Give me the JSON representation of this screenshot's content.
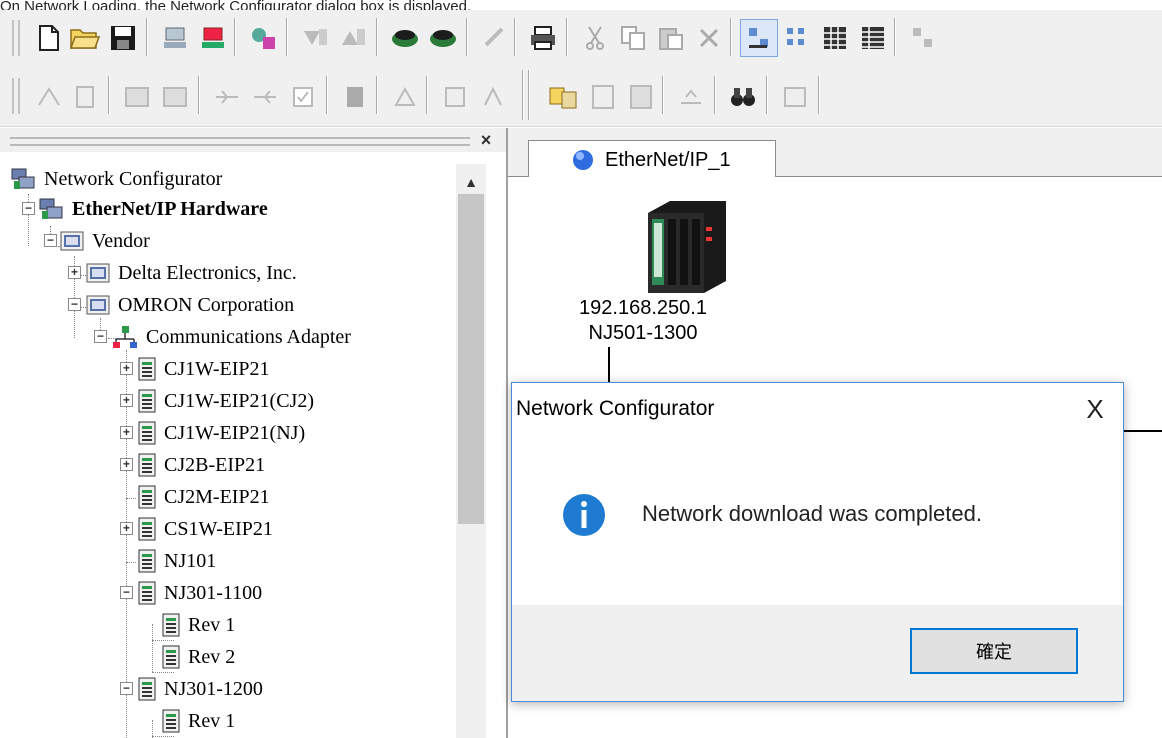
{
  "caption": "On Network Loading, the Network Configurator dialog box is displayed.",
  "toolbar1": {
    "buttons": [
      "new-file",
      "open-folder",
      "save",
      "online",
      "offline",
      "wizard",
      "upload-down",
      "upload",
      "upload-network",
      "download-network",
      "compare",
      "print",
      "cut",
      "copy",
      "paste",
      "delete",
      "view-large-icons",
      "view-small-icons",
      "view-list",
      "view-details",
      "more"
    ]
  },
  "toolbar2": {
    "buttons": [
      "monitor",
      "properties",
      "parameter-edit",
      "parameter-save",
      "online-a",
      "online-b",
      "checkbox",
      "register",
      "device-props",
      "device-list",
      "network-map",
      "eds-install",
      "eds-create",
      "eds-save",
      "eds-export",
      "find",
      "help"
    ]
  },
  "panel": {
    "close_symbol": "×",
    "scroll_up": "▲"
  },
  "tree": [
    {
      "label": "Network Configurator",
      "icon": "network-configurator-icon",
      "bold": false
    },
    {
      "label": "EtherNet/IP Hardware",
      "icon": "ethernet-hardware-icon",
      "bold": true,
      "expanded": true
    },
    {
      "label": "Vendor",
      "icon": "vendor-folder-icon",
      "bold": false,
      "expanded": true
    },
    {
      "label": "Delta Electronics, Inc.",
      "icon": "vendor-folder-icon",
      "bold": false,
      "expanded": false
    },
    {
      "label": "OMRON Corporation",
      "icon": "vendor-folder-icon",
      "bold": false,
      "expanded": true
    },
    {
      "label": "Communications Adapter",
      "icon": "communications-adapter-icon",
      "bold": false,
      "expanded": true
    },
    {
      "label": "CJ1W-EIP21",
      "icon": "device-icon",
      "expanded": false
    },
    {
      "label": "CJ1W-EIP21(CJ2)",
      "icon": "device-icon",
      "expanded": false
    },
    {
      "label": "CJ1W-EIP21(NJ)",
      "icon": "device-icon",
      "expanded": false
    },
    {
      "label": "CJ2B-EIP21",
      "icon": "device-icon",
      "expanded": false
    },
    {
      "label": "CJ2M-EIP21",
      "icon": "device-icon"
    },
    {
      "label": "CS1W-EIP21",
      "icon": "device-icon",
      "expanded": false
    },
    {
      "label": "NJ101",
      "icon": "device-icon"
    },
    {
      "label": "NJ301-1100",
      "icon": "device-icon",
      "expanded": true
    },
    {
      "label": "Rev 1",
      "icon": "device-icon"
    },
    {
      "label": "Rev 2",
      "icon": "device-icon"
    },
    {
      "label": "NJ301-1200",
      "icon": "device-icon",
      "expanded": true
    },
    {
      "label": "Rev 1",
      "icon": "device-icon"
    }
  ],
  "tab": {
    "label": "EtherNet/IP_1",
    "icon": "network-globe-icon"
  },
  "canvas": {
    "device_ip": "192.168.250.1",
    "device_model": "NJ501-1300"
  },
  "dialog": {
    "title": "Network Configurator",
    "close_symbol": "X",
    "message": "Network download was completed.",
    "icon": "info-icon",
    "ok_label": "確定"
  },
  "colors": {
    "accent": "#0078d7",
    "info_icon": "#1f7bd1",
    "tab_globe": "#2d6de0",
    "toolbar_bg": "#f0f0f0",
    "device_green": "#2e8b57"
  }
}
